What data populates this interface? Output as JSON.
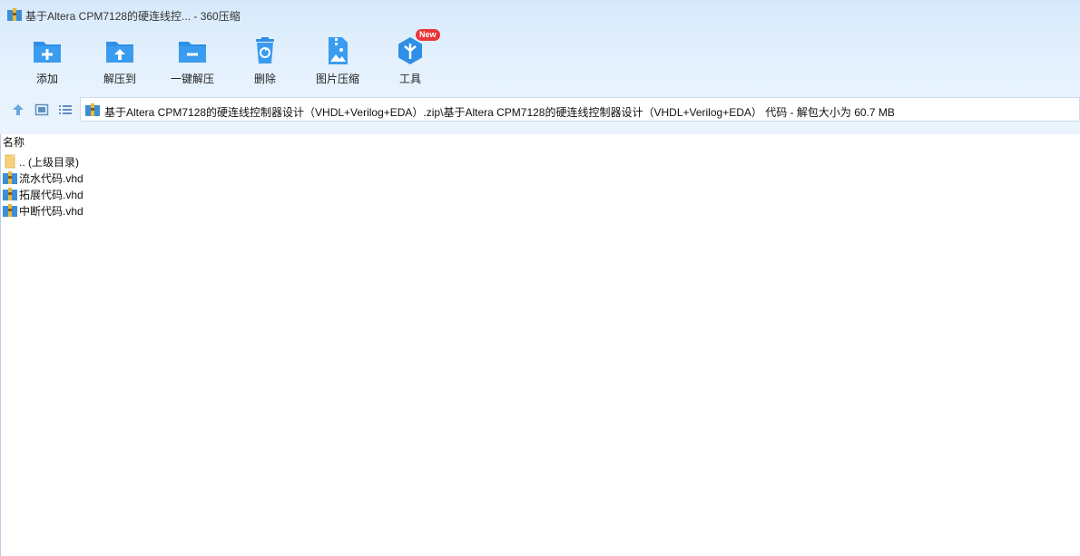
{
  "window": {
    "title": "基于Altera CPM7128的硬连线控... - 360压缩"
  },
  "toolbar": {
    "items": [
      {
        "label": "添加",
        "icon": "folder-add-icon"
      },
      {
        "label": "解压到",
        "icon": "folder-extract-icon"
      },
      {
        "label": "一键解压",
        "icon": "folder-minus-icon"
      },
      {
        "label": "删除",
        "icon": "trash-icon"
      },
      {
        "label": "图片压缩",
        "icon": "image-compress-icon"
      },
      {
        "label": "工具",
        "icon": "tools-cube-icon"
      }
    ],
    "new_badge": "New"
  },
  "address": {
    "path": "基于Altera CPM7128的硬连线控制器设计（VHDL+Verilog+EDA）.zip\\基于Altera CPM7128的硬连线控制器设计（VHDL+Verilog+EDA） 代码 - 解包大小为 60.7 MB"
  },
  "file_list": {
    "column_name": "名称",
    "items": [
      {
        "name": ".. (上级目录)",
        "icon": "folder-icon"
      },
      {
        "name": "流水代码.vhd",
        "icon": "archive-file-icon"
      },
      {
        "name": "拓展代码.vhd",
        "icon": "archive-file-icon"
      },
      {
        "name": "中断代码.vhd",
        "icon": "archive-file-icon"
      }
    ]
  },
  "colors": {
    "accent": "#2e8fe6",
    "badge": "#e8373a"
  }
}
